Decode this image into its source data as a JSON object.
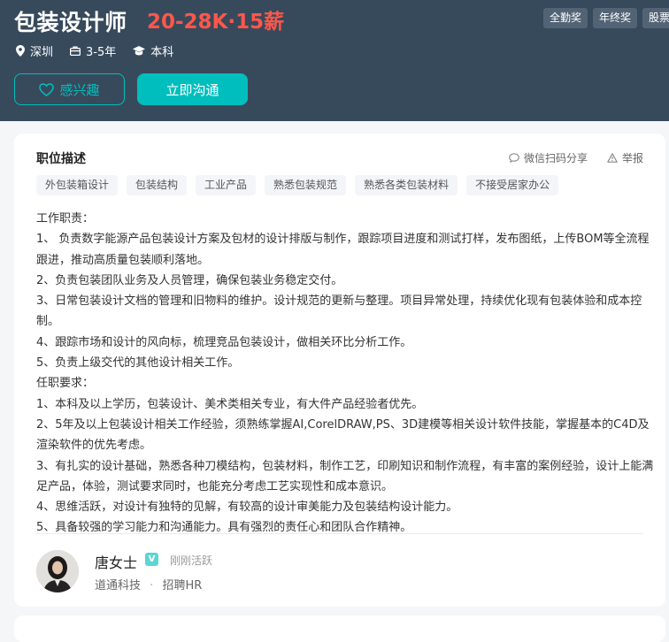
{
  "job": {
    "title": "包装设计师",
    "salary": "20-28K·15薪",
    "welfare": [
      "全勤奖",
      "年终奖",
      "股票"
    ],
    "meta": {
      "city": "深圳",
      "experience": "3-5年",
      "degree": "本科"
    },
    "actions": {
      "interest_label": "感兴趣",
      "chat_label": "立即沟通"
    }
  },
  "description": {
    "section_title": "职位描述",
    "share_label": "微信扫码分享",
    "report_label": "举报",
    "tags": [
      "外包装箱设计",
      "包装结构",
      "工业产品",
      "熟悉包装规范",
      "熟悉各类包装材料",
      "不接受居家办公"
    ],
    "lines": [
      "工作职责：",
      "1、 负责数字能源产品包装设计方案及包材的设计排版与制作，跟踪项目进度和测试打样，发布图纸，上传BOM等全流程跟进，推动高质量包装顺利落地。",
      "2、负责包装团队业务及人员管理，确保包装业务稳定交付。",
      "3、日常包装设计文档的管理和旧物料的维护。设计规范的更新与整理。项目异常处理，持续优化现有包装体验和成本控制。",
      "4、跟踪市场和设计的风向标，梳理竞品包装设计，做相关环比分析工作。",
      "5、负责上级交代的其他设计相关工作。",
      "任职要求：",
      "1、本科及以上学历，包装设计、美术类相关专业，有大件产品经验者优先。",
      "2、5年及以上包装设计相关工作经验，须熟练掌握AI,CorelDRAW,PS、3D建模等相关设计软件技能，掌握基本的C4D及渲染软件的优先考虑。",
      "3、有扎实的设计基础，熟悉各种刀模结构，包装材料，制作工艺，印刷知识和制作流程，有丰富的案例经验，设计上能满足产品，体验，测试要求同时，也能充分考虑工艺实现性和成本意识。",
      "4、思维活跃，对设计有独特的见解，有较高的设计审美能力及包装结构设计能力。",
      "5、具备较强的学习能力和沟通能力。具有强烈的责任心和团队合作精神。"
    ]
  },
  "recruiter": {
    "name": "唐女士",
    "badge": "V",
    "status": "刚刚活跃",
    "company": "道通科技",
    "separator": "·",
    "role": "招聘HR"
  },
  "colors": {
    "header_bg": "#374a5c",
    "accent": "#00bebd",
    "salary": "#fe574a"
  },
  "icons": [
    "location-icon",
    "briefcase-icon",
    "graduation-cap-icon",
    "heart-icon",
    "wechat-icon",
    "warning-icon"
  ]
}
